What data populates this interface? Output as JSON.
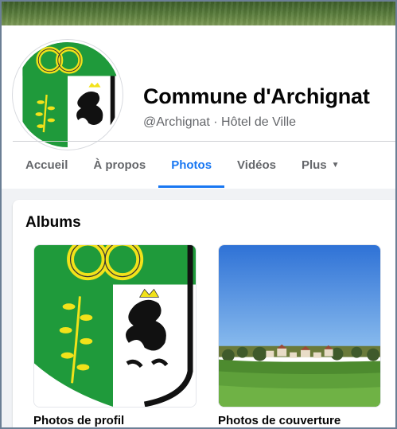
{
  "page": {
    "title": "Commune d'Archignat",
    "subtitle": "@Archignat · Hôtel de Ville"
  },
  "tabs": [
    {
      "label": "Accueil",
      "active": false
    },
    {
      "label": "À propos",
      "active": false
    },
    {
      "label": "Photos",
      "active": true
    },
    {
      "label": "Vidéos",
      "active": false
    },
    {
      "label": "Plus",
      "active": false,
      "icon": "caret-down-icon"
    }
  ],
  "albums": {
    "title": "Albums",
    "items": [
      {
        "label": "Photos de profil",
        "image": "coat-of-arms"
      },
      {
        "label": "Photos de couverture",
        "image": "village-landscape"
      }
    ]
  },
  "colors": {
    "accent": "#1877f2",
    "shield_green": "#1f9a3b",
    "ring_yellow": "#f2e21a"
  }
}
